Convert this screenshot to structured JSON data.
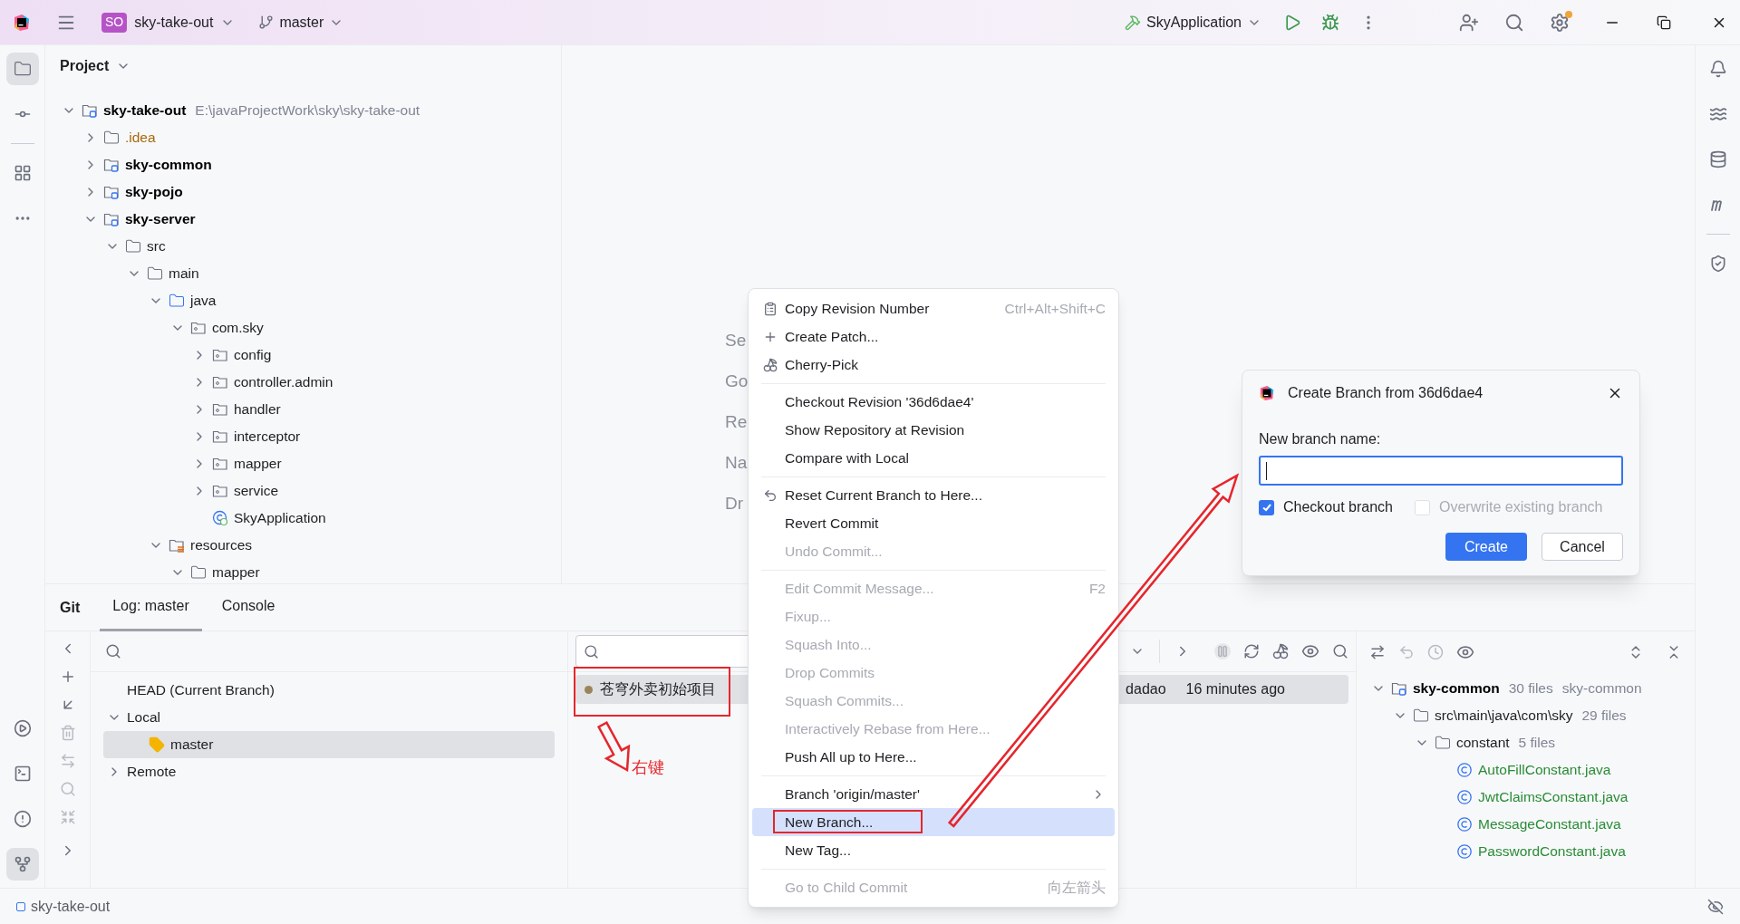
{
  "title_bar": {
    "project_badge": "SO",
    "project": "sky-take-out",
    "branch": "master",
    "run_config": "SkyApplication"
  },
  "project_panel": {
    "title": "Project",
    "tree": [
      {
        "name": "sky-take-out",
        "kind": "module",
        "hints": [
          "E:\\javaProjectWork\\sky\\sky-take-out"
        ],
        "expanded": true,
        "children": [
          {
            "name": ".idea",
            "kind": "idea",
            "expanded": false
          },
          {
            "name": "sky-common",
            "kind": "module",
            "expanded": false
          },
          {
            "name": "sky-pojo",
            "kind": "module",
            "expanded": false
          },
          {
            "name": "sky-server",
            "kind": "module",
            "expanded": true,
            "children": [
              {
                "name": "src",
                "kind": "folder",
                "expanded": true,
                "children": [
                  {
                    "name": "main",
                    "kind": "folder",
                    "expanded": true,
                    "children": [
                      {
                        "name": "java",
                        "kind": "source",
                        "expanded": true,
                        "children": [
                          {
                            "name": "com.sky",
                            "kind": "package",
                            "expanded": true,
                            "children": [
                              {
                                "name": "config",
                                "kind": "package",
                                "expanded": false
                              },
                              {
                                "name": "controller.admin",
                                "kind": "package",
                                "expanded": false
                              },
                              {
                                "name": "handler",
                                "kind": "package",
                                "expanded": false
                              },
                              {
                                "name": "interceptor",
                                "kind": "package",
                                "expanded": false
                              },
                              {
                                "name": "mapper",
                                "kind": "package",
                                "expanded": false
                              },
                              {
                                "name": "service",
                                "kind": "package",
                                "expanded": false
                              },
                              {
                                "name": "SkyApplication",
                                "kind": "app"
                              }
                            ]
                          }
                        ]
                      },
                      {
                        "name": "resources",
                        "kind": "resources",
                        "expanded": true,
                        "children": [
                          {
                            "name": "mapper",
                            "kind": "folder",
                            "expanded": true
                          }
                        ]
                      }
                    ]
                  }
                ]
              }
            ]
          }
        ]
      }
    ]
  },
  "editor_hints": [
    "Se",
    "Go",
    "Re",
    "Na",
    "Dr"
  ],
  "git_panel": {
    "title": "Git",
    "tabs": [
      {
        "label": "Log: master",
        "selected": true
      },
      {
        "label": "Console",
        "selected": false
      }
    ],
    "branches": [
      {
        "name": "HEAD (Current Branch)",
        "selected": false
      },
      {
        "name": "Local",
        "expanded": true,
        "selected": false,
        "children": [
          {
            "name": "master",
            "kind": "branch",
            "selected": true
          }
        ]
      },
      {
        "name": "Remote",
        "expanded": false,
        "selected": false
      }
    ],
    "commits": [
      {
        "message": "苍穹外卖初始项目",
        "author": "dadao",
        "date": "16 minutes ago",
        "selected": true,
        "color": "#9c845a"
      }
    ],
    "changes": [
      {
        "name": "sky-common",
        "kind": "module",
        "hints": [
          "30 files",
          "sky-common"
        ],
        "expanded": true,
        "children": [
          {
            "name": "src\\main\\java\\com\\sky",
            "kind": "folder",
            "hints": [
              "29 files"
            ],
            "expanded": true,
            "children": [
              {
                "name": "constant",
                "kind": "folder",
                "hints": [
                  "5 files"
                ],
                "expanded": true,
                "children": [
                  {
                    "name": "AutoFillConstant.java",
                    "kind": "new_class"
                  },
                  {
                    "name": "JwtClaimsConstant.java",
                    "kind": "new_class"
                  },
                  {
                    "name": "MessageConstant.java",
                    "kind": "new_class"
                  },
                  {
                    "name": "PasswordConstant.java",
                    "kind": "new_class"
                  }
                ]
              }
            ]
          }
        ]
      }
    ]
  },
  "annotation": {
    "label": "右键"
  },
  "context_menu": [
    {
      "kind": "item",
      "label": "Copy Revision Number",
      "shortcut": "Ctrl+Alt+Shift+C",
      "disabled": false,
      "selected": false
    },
    {
      "kind": "item",
      "label": "Create Patch...",
      "disabled": false,
      "selected": false
    },
    {
      "kind": "item",
      "label": "Cherry-Pick",
      "disabled": false,
      "selected": false
    },
    {
      "kind": "separator"
    },
    {
      "kind": "item",
      "label": "Checkout Revision '36d6dae4'",
      "disabled": false,
      "selected": false
    },
    {
      "kind": "item",
      "label": "Show Repository at Revision",
      "disabled": false,
      "selected": false
    },
    {
      "kind": "item",
      "label": "Compare with Local",
      "disabled": false,
      "selected": false
    },
    {
      "kind": "separator"
    },
    {
      "kind": "item",
      "label": "Reset Current Branch to Here...",
      "disabled": false,
      "selected": false
    },
    {
      "kind": "item",
      "label": "Revert Commit",
      "disabled": false,
      "selected": false
    },
    {
      "kind": "item",
      "label": "Undo Commit...",
      "disabled": true,
      "selected": false
    },
    {
      "kind": "separator"
    },
    {
      "kind": "item",
      "label": "Edit Commit Message...",
      "shortcut": "F2",
      "disabled": true,
      "selected": false
    },
    {
      "kind": "item",
      "label": "Fixup...",
      "disabled": true,
      "selected": false
    },
    {
      "kind": "item",
      "label": "Squash Into...",
      "disabled": true,
      "selected": false
    },
    {
      "kind": "item",
      "label": "Drop Commits",
      "disabled": true,
      "selected": false
    },
    {
      "kind": "item",
      "label": "Squash Commits...",
      "disabled": true,
      "selected": false
    },
    {
      "kind": "item",
      "label": "Interactively Rebase from Here...",
      "disabled": true,
      "selected": false
    },
    {
      "kind": "item",
      "label": "Push All up to Here...",
      "disabled": false,
      "selected": false
    },
    {
      "kind": "separator"
    },
    {
      "kind": "item",
      "label": "Branch 'origin/master'",
      "submenu": true,
      "disabled": false,
      "selected": false
    },
    {
      "kind": "item",
      "label": "New Branch...",
      "disabled": false,
      "selected": true
    },
    {
      "kind": "item",
      "label": "New Tag...",
      "disabled": false,
      "selected": false
    },
    {
      "kind": "separator"
    },
    {
      "kind": "item",
      "label": "Go to Child Commit",
      "shortcut": "向左箭头",
      "disabled": true,
      "selected": false
    }
  ],
  "dialog": {
    "title": "Create Branch from 36d6dae4",
    "field_label": "New branch name:",
    "checkboxes": [
      {
        "label": "Checkout branch",
        "checked": true,
        "disabled": false
      },
      {
        "label": "Overwrite existing branch",
        "checked": false,
        "disabled": true
      }
    ],
    "buttons": [
      {
        "label": "Create",
        "kind": "primary"
      },
      {
        "label": "Cancel",
        "kind": "secondary"
      }
    ]
  },
  "status_bar": {
    "project": "sky-take-out"
  }
}
